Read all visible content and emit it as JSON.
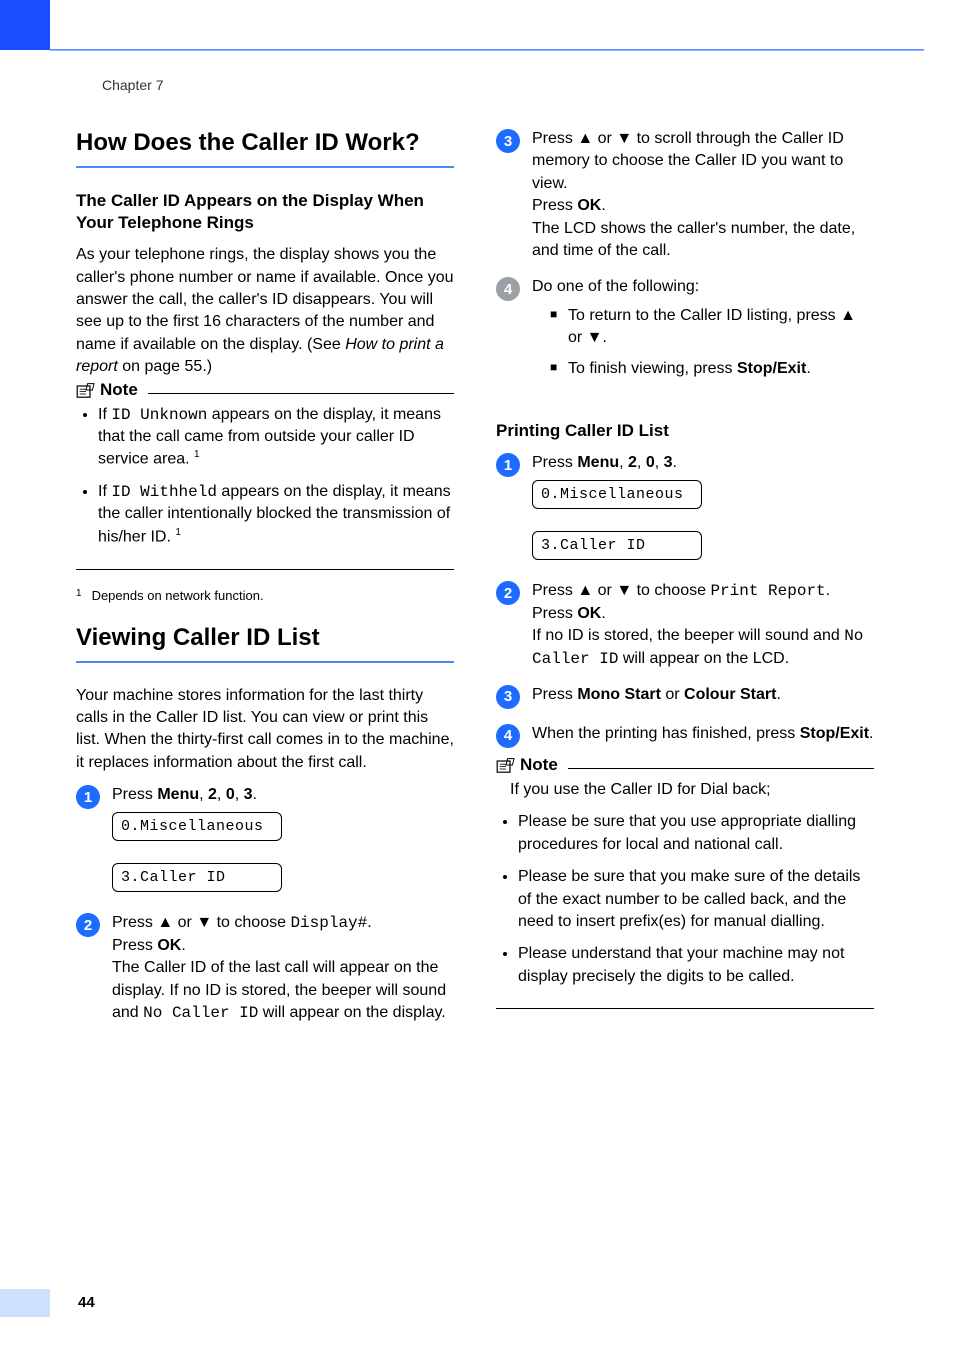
{
  "meta": {
    "chapter": "Chapter 7",
    "page_number": "44"
  },
  "left": {
    "h2_1": "How Does the Caller ID Work?",
    "sub1": "The Caller ID Appears on the Display When Your Telephone Rings",
    "p1a": "As your telephone rings, the display shows you the caller's phone number or name if available. Once you answer the call, the caller's ID disappears. You will see up to the first 16 characters of the number and name if available on the display. (See ",
    "p1b_italic": "How to print a report",
    "p1c": " on page 55.)",
    "note_label": "Note",
    "note1_a": "If ",
    "note1_mono": "ID Unknown",
    "note1_b": " appears on the display, it means that the call came from outside your caller ID service area. ",
    "note1_sup": "1",
    "note2_a": "If ",
    "note2_mono": "ID Withheld",
    "note2_b": " appears on the display, it means the caller intentionally blocked the transmission of his/her ID. ",
    "note2_sup": "1",
    "footnote_mark": "1",
    "footnote_text": "Depends on network function.",
    "h2_2": "Viewing Caller ID List",
    "p2": "Your machine stores information for the last thirty calls in the Caller ID list. You can view or print this list. When the thirty-first call comes in to the machine, it replaces information about the first call.",
    "step1_a": "Press ",
    "step1_menu": "Menu",
    "step1_b": ", ",
    "step1_2": "2",
    "step1_c": ", ",
    "step1_0": "0",
    "step1_d": ", ",
    "step1_3": "3",
    "step1_e": ".",
    "lcd1": "0.Miscellaneous",
    "lcd2": "3.Caller ID",
    "step2_a": "Press ",
    "step2_up": "▲",
    "step2_b": " or ",
    "step2_down": "▼",
    "step2_c": " to choose ",
    "step2_mono": "Display#",
    "step2_d": ".",
    "step2_e": "Press ",
    "step2_ok": "OK",
    "step2_f": ".",
    "step2_g": "The Caller ID of the last call will appear on the display. If no ID is stored, the beeper will sound and ",
    "step2_mono2": "No Caller ID",
    "step2_h": " will appear on the display."
  },
  "right": {
    "step3_a": "Press ",
    "step3_up": "▲",
    "step3_b": " or ",
    "step3_down": "▼",
    "step3_c": " to scroll through the Caller ID memory to choose the Caller ID you want to view.",
    "step3_d": "Press ",
    "step3_ok": "OK",
    "step3_e": ".",
    "step3_f": "The LCD shows the caller's number, the date, and time of the call.",
    "step4_a": "Do one of the following:",
    "step4_li1_a": "To return to the Caller ID listing, press ",
    "step4_li1_up": "▲",
    "step4_li1_b": " or ",
    "step4_li1_down": "▼",
    "step4_li1_c": ".",
    "step4_li2_a": "To finish viewing, press ",
    "step4_li2_bold": "Stop/Exit",
    "step4_li2_b": ".",
    "sub2": "Printing Caller ID List",
    "pstep1_a": "Press ",
    "pstep1_menu": "Menu",
    "pstep1_b": ", ",
    "pstep1_2": "2",
    "pstep1_c": ", ",
    "pstep1_0": "0",
    "pstep1_d": ", ",
    "pstep1_3": "3",
    "pstep1_e": ".",
    "plcd1": "0.Miscellaneous",
    "plcd2": "3.Caller ID",
    "pstep2_a": "Press ",
    "pstep2_up": "▲",
    "pstep2_b": " or ",
    "pstep2_down": "▼",
    "pstep2_c": " to choose ",
    "pstep2_mono": "Print Report",
    "pstep2_d": ".",
    "pstep2_e": "Press ",
    "pstep2_ok": "OK",
    "pstep2_f": ".",
    "pstep2_g": "If no ID is stored, the beeper will sound and ",
    "pstep2_mono2": "No Caller ID",
    "pstep2_h": " will appear on the LCD.",
    "pstep3_a": "Press ",
    "pstep3_b": "Mono Start",
    "pstep3_c": " or ",
    "pstep3_d": "Colour Start",
    "pstep3_e": ".",
    "pstep4_a": "When the printing has finished, press ",
    "pstep4_b": "Stop/Exit",
    "pstep4_c": ".",
    "note_label": "Note",
    "note_intro": "If you use the Caller ID for Dial back;",
    "note_li1": "Please be sure that you use appropriate dialling procedures for local and national call.",
    "note_li2": "Please be sure that you make sure of the details of the exact number to be called back, and the need to insert prefix(es) for manual dialling.",
    "note_li3": "Please understand that your machine may not display precisely the digits to be called."
  }
}
